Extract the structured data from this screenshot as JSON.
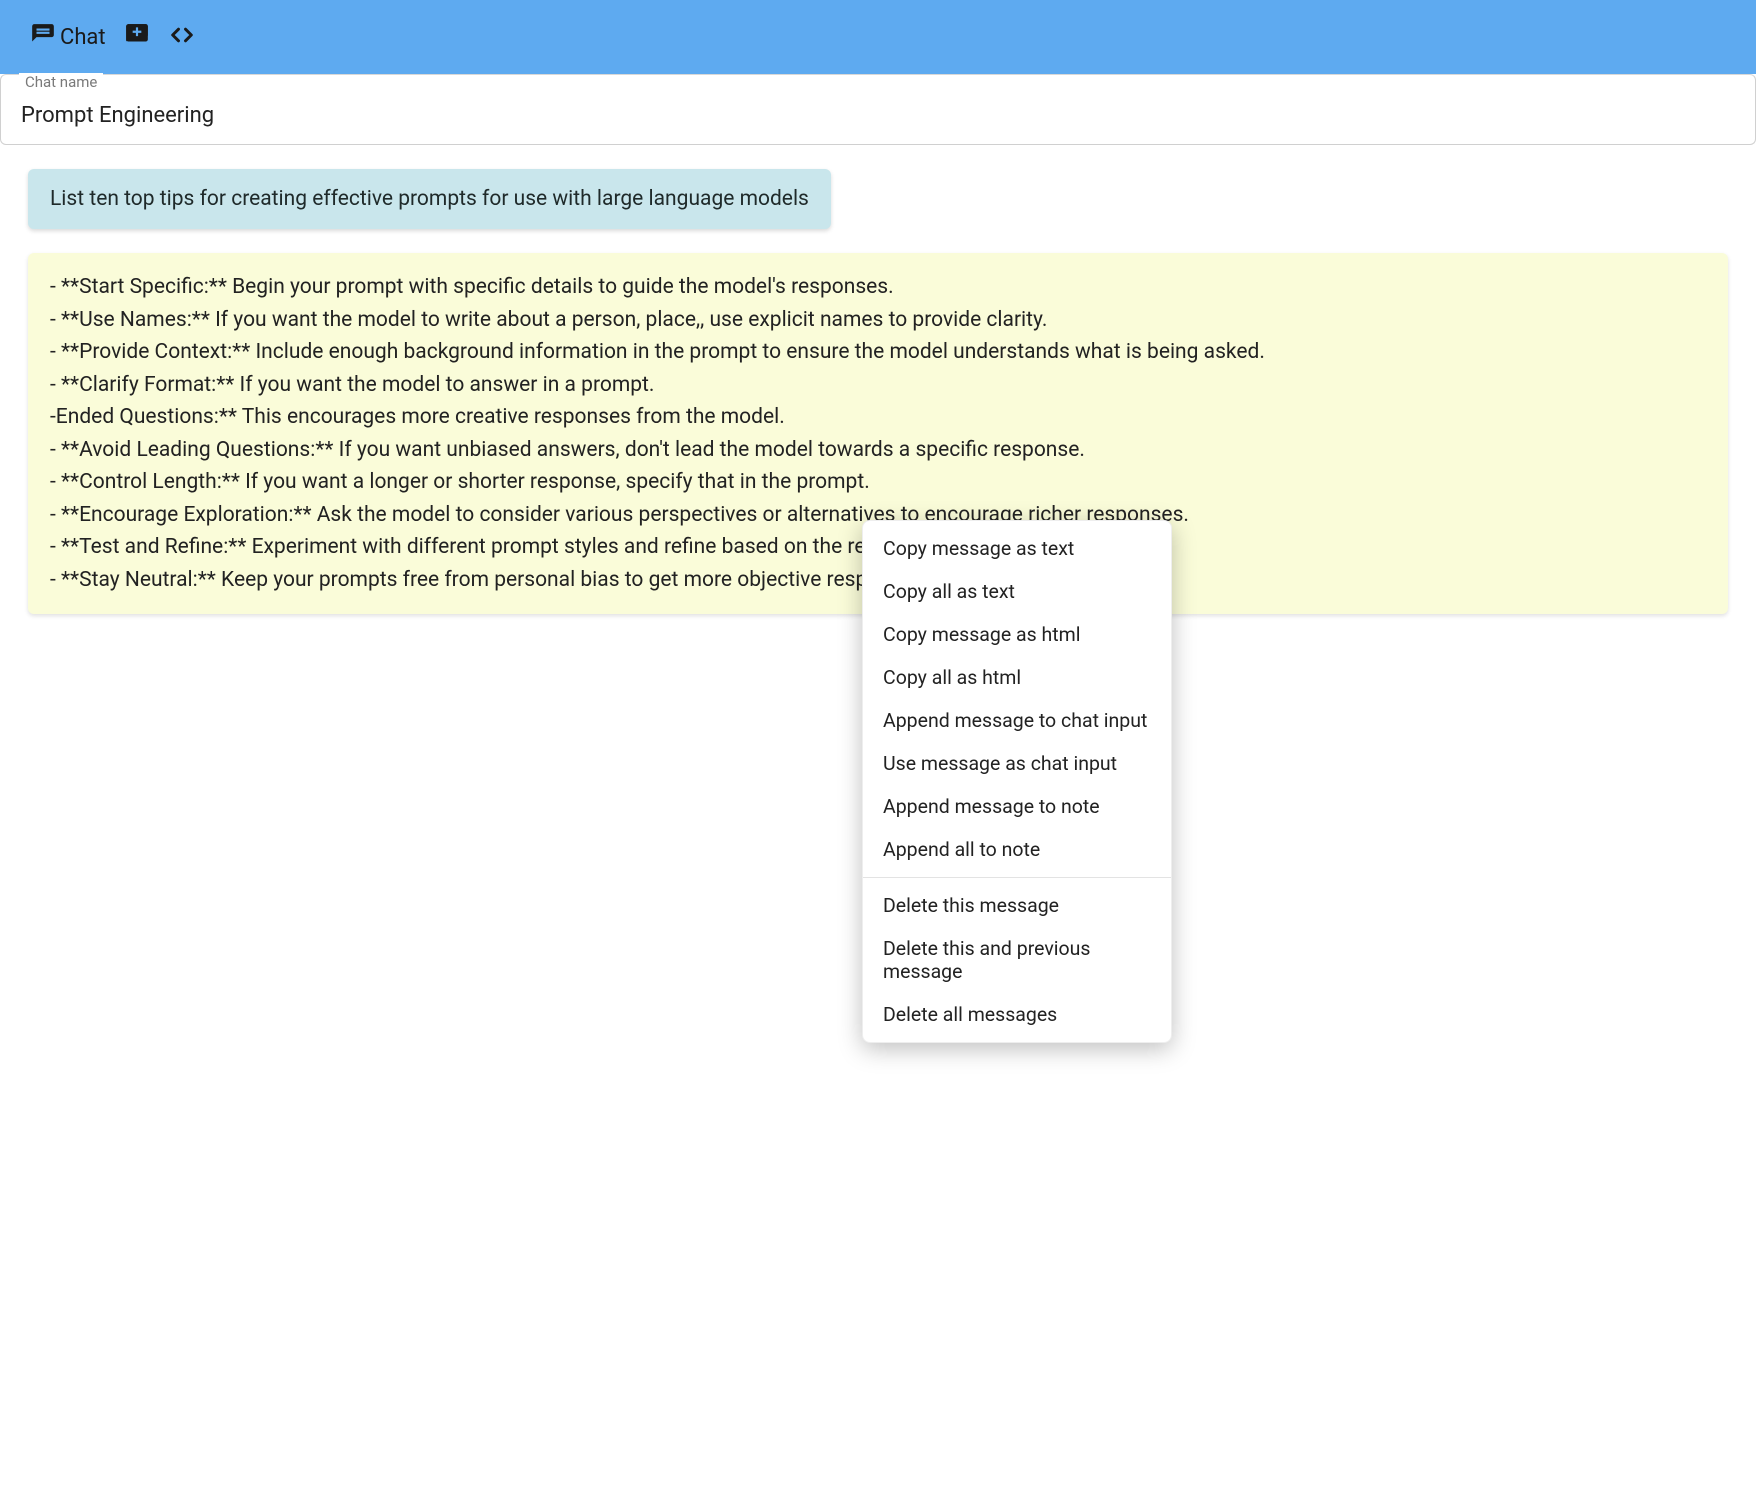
{
  "toolbar": {
    "chat_label": "Chat"
  },
  "chat_name": {
    "legend": "Chat name",
    "value": "Prompt Engineering"
  },
  "user_message": "List ten top tips for creating effective prompts for use with large language models",
  "assistant_message_lines": [
    " - **Start Specific:** Begin your prompt with specific details to guide the model's responses.",
    " - **Use Names:** If you want the model to write about a person, place,, use explicit names to provide clarity.",
    " - **Provide Context:** Include enough background information in the prompt to ensure the model understands what is being asked.",
    " - **Clarify Format:** If you want the model to answer in a prompt.",
    "-Ended Questions:** This encourages more creative responses from the model.",
    " - **Avoid Leading Questions:** If you want unbiased answers, don't lead the model towards a specific response.",
    " - **Control Length:** If you want a longer or shorter response, specify that in the prompt.",
    " - **Encourage Exploration:** Ask the model to consider various perspectives or alternatives to encourage richer responses.",
    " - **Test and Refine:** Experiment with different prompt styles and refine based on the results.",
    " - **Stay Neutral:** Keep your prompts free from personal bias to get more objective responses."
  ],
  "context_menu": {
    "section1": [
      "Copy message as text",
      "Copy all as text",
      "Copy message as html",
      "Copy all as html",
      "Append message to chat input",
      "Use message as chat input",
      "Append message to note",
      "Append all to note"
    ],
    "section2": [
      "Delete this message",
      "Delete this and previous message",
      "Delete all messages"
    ]
  }
}
